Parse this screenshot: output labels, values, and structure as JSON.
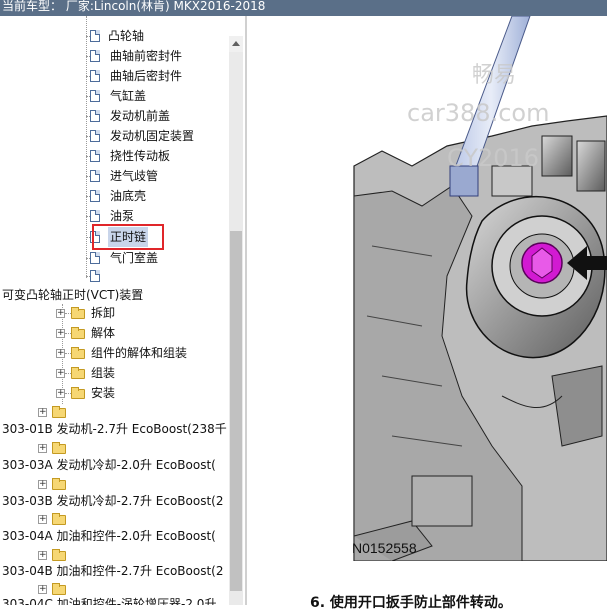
{
  "header": {
    "vehicle_label": "当前车型： 厂家:Lincoln(林肯) MKX2016-2018"
  },
  "tree": {
    "items": [
      {
        "label": "凸轮轴"
      },
      {
        "label": "曲轴前密封件"
      },
      {
        "label": "曲轴后密封件"
      },
      {
        "label": "气缸盖"
      },
      {
        "label": "发动机前盖"
      },
      {
        "label": "发动机固定装置"
      },
      {
        "label": "挠性传动板"
      },
      {
        "label": "进气歧管"
      },
      {
        "label": "油底壳"
      },
      {
        "label": "油泵"
      },
      {
        "label": "正时链"
      },
      {
        "label": "气门室盖"
      },
      {
        "label": ""
      }
    ],
    "vct_title": "可变凸轮轴正时(VCT)装置",
    "vct_children": [
      {
        "label": "拆卸"
      },
      {
        "label": "解体"
      },
      {
        "label": "组件的解体和组装"
      },
      {
        "label": "组装"
      },
      {
        "label": "安装"
      }
    ],
    "sections": [
      {
        "label": "303-01B 发动机-2.7升 EcoBoost(238千"
      },
      {
        "label": "303-03A 发动机冷却-2.0升 EcoBoost("
      },
      {
        "label": "303-03B 发动机冷却-2.7升 EcoBoost(2"
      },
      {
        "label": "303-04A 加油和控件-2.0升 EcoBoost("
      },
      {
        "label": "303-04B 加油和控件-2.7升 EcoBoost(2"
      },
      {
        "label": "303-04C 加油和控件-涡轮增压器-2.0升"
      }
    ]
  },
  "figure": {
    "watermark_lines": [
      "畅易",
      "car388.com",
      "CY2016"
    ],
    "caption": "N0152558"
  },
  "content": {
    "step_text": "6. 使用开口扳手防止部件转动。"
  },
  "colors": {
    "topbar": "#5a6f88",
    "selection": "#c9d5ea",
    "highlight": "#e0262a",
    "magenta": "#d21ad2"
  }
}
